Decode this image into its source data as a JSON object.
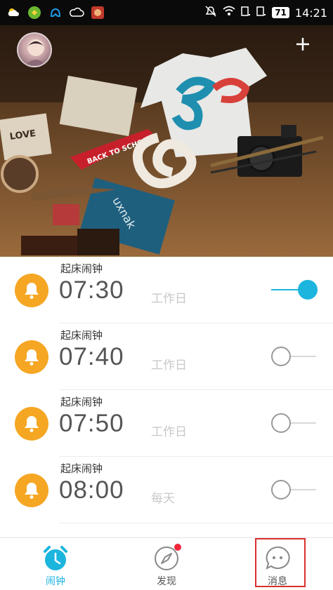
{
  "status_bar": {
    "battery": "71",
    "time": "14:21"
  },
  "colors": {
    "accent": "#1cb5de",
    "bell": "#f5a623",
    "badge": "#f2283a",
    "highlight": "#d8302e"
  },
  "alarms": [
    {
      "label": "起床闹钟",
      "time": "07:30",
      "repeat": "工作日",
      "enabled": true
    },
    {
      "label": "起床闹钟",
      "time": "07:40",
      "repeat": "工作日",
      "enabled": false
    },
    {
      "label": "起床闹钟",
      "time": "07:50",
      "repeat": "工作日",
      "enabled": false
    },
    {
      "label": "起床闹钟",
      "time": "08:00",
      "repeat": "每天",
      "enabled": false
    }
  ],
  "nav": {
    "alarm": "闹钟",
    "discover": "发现",
    "messages": "消息"
  },
  "hero": {
    "pennant_text": "BACK TO SCHOOL",
    "book_text": "LOVE",
    "card_text": "uxnak"
  }
}
